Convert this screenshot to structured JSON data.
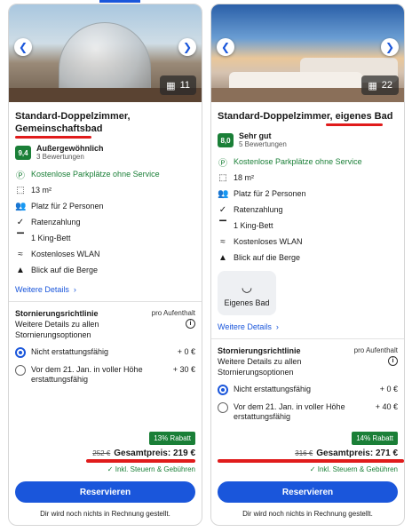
{
  "colors": {
    "accent": "#1a56db",
    "green": "#1a7f37",
    "redaction": "#e01b1b"
  },
  "cards": [
    {
      "photo_count": "11",
      "room_title": "Standard-Doppelzimmer, Gemeinschaftsbad",
      "rating_score": "9,4",
      "rating_label": "Außergewöhnlich",
      "rating_count": "3 Bewertungen",
      "features": [
        {
          "icon": "parking-icon",
          "text": "Kostenlose Parkplätze ohne Service",
          "green": true
        },
        {
          "icon": "size-icon",
          "text": "13 m²"
        },
        {
          "icon": "people-icon",
          "text": "Platz für 2 Personen"
        },
        {
          "icon": "check-icon",
          "text": "Ratenzahlung"
        },
        {
          "icon": "bed-icon",
          "text": "1 King-Bett"
        },
        {
          "icon": "wifi-icon",
          "text": "Kostenloses WLAN"
        },
        {
          "icon": "mountain-icon",
          "text": "Blick auf die Berge"
        }
      ],
      "details_link": "Weitere Details",
      "cancel_title": "Stornierungsrichtlinie",
      "per_stay": "pro Aufenthalt",
      "cancel_desc": "Weitere Details zu allen Stornierungsoptionen",
      "options": [
        {
          "label": "Nicht erstattungsfähig",
          "price": "+ 0 €",
          "selected": true
        },
        {
          "label": "Vor dem 21. Jan. in voller Höhe erstattungsfähig",
          "price": "+ 30 €",
          "selected": false
        }
      ],
      "discount": "13% Rabatt",
      "old_price": "252 €",
      "total": "Gesamtpreis: 219 €",
      "taxes": "Inkl. Steuern & Gebühren",
      "reserve": "Reservieren",
      "note": "Dir wird noch nichts in Rechnung gestellt."
    },
    {
      "photo_count": "22",
      "room_title": "Standard-Doppelzimmer, eigenes Bad",
      "rating_score": "8,0",
      "rating_label": "Sehr gut",
      "rating_count": "5 Bewertungen",
      "features": [
        {
          "icon": "parking-icon",
          "text": "Kostenlose Parkplätze ohne Service",
          "green": true
        },
        {
          "icon": "size-icon",
          "text": "18 m²"
        },
        {
          "icon": "people-icon",
          "text": "Platz für 2 Personen"
        },
        {
          "icon": "check-icon",
          "text": "Ratenzahlung"
        },
        {
          "icon": "bed-icon",
          "text": "1 King-Bett"
        },
        {
          "icon": "wifi-icon",
          "text": "Kostenloses WLAN"
        },
        {
          "icon": "mountain-icon",
          "text": "Blick auf die Berge"
        }
      ],
      "amenity": {
        "icon": "bathtub-icon",
        "label": "Eigenes Bad"
      },
      "details_link": "Weitere Details",
      "cancel_title": "Stornierungsrichtlinie",
      "per_stay": "pro Aufenthalt",
      "cancel_desc": "Weitere Details zu allen Stornierungsoptionen",
      "options": [
        {
          "label": "Nicht erstattungsfähig",
          "price": "+ 0 €",
          "selected": true
        },
        {
          "label": "Vor dem 21. Jan. in voller Höhe erstattungsfähig",
          "price": "+ 40 €",
          "selected": false
        }
      ],
      "discount": "14% Rabatt",
      "old_price": "316 €",
      "total": "Gesamtpreis: 271 €",
      "taxes": "Inkl. Steuern & Gebühren",
      "reserve": "Reservieren",
      "note": "Dir wird noch nichts in Rechnung gestellt."
    }
  ]
}
